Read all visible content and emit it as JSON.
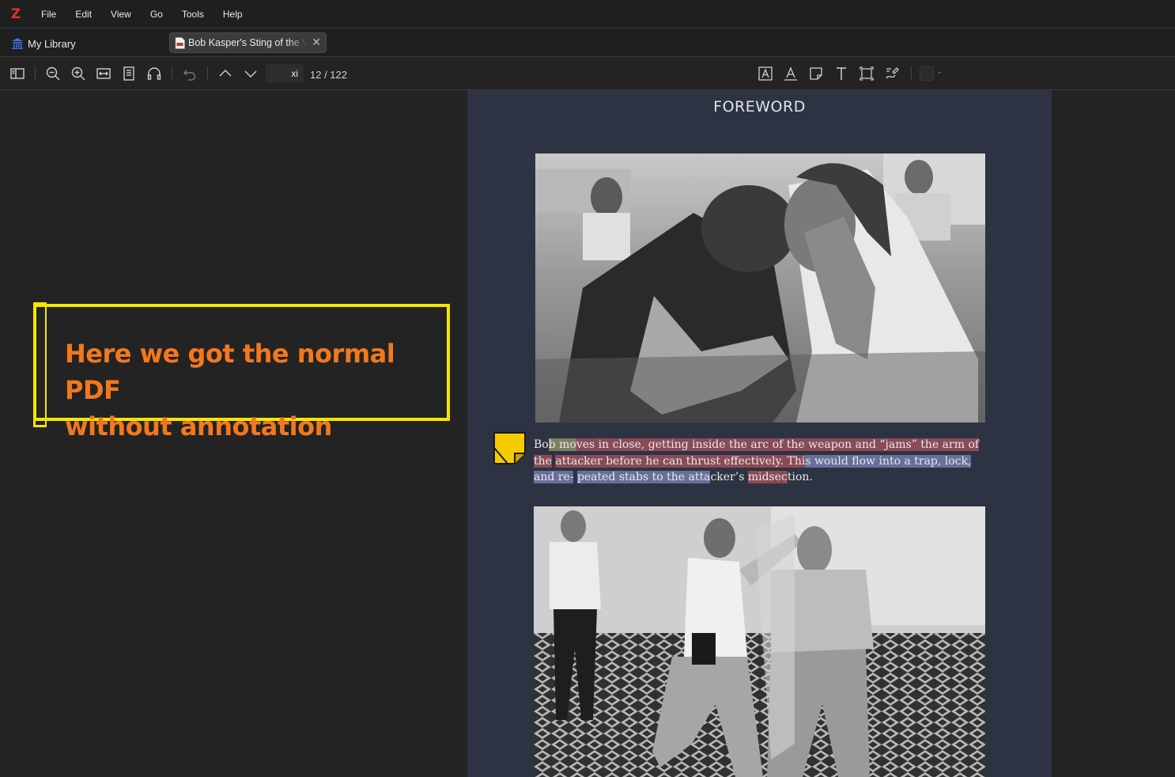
{
  "app": {
    "logo": "Z",
    "menu": [
      "File",
      "Edit",
      "View",
      "Go",
      "Tools",
      "Help"
    ]
  },
  "tabs": {
    "library_label": "My Library",
    "doc_title": "Bob Kasper's Sting of the Viper"
  },
  "toolbar": {
    "page_label": "xi",
    "page_count": "12 / 122",
    "icons": [
      "sidebar-toggle-icon",
      "zoom-out-icon",
      "zoom-in-icon",
      "fit-width-icon",
      "page-view-icon",
      "read-aloud-icon",
      "undo-icon",
      "previous-page-icon",
      "next-page-icon",
      "highlight-text-icon",
      "underline-text-icon",
      "add-note-icon",
      "add-text-icon",
      "select-area-icon",
      "draw-icon",
      "color-picker-icon"
    ]
  },
  "callout": {
    "line1": "Here we got the normal PDF",
    "line2": "without annotation"
  },
  "page": {
    "heading": "FOREWORD",
    "caption": {
      "seg1": "Bo",
      "seg2": "b mo",
      "seg3": "ves in close, getting inside the arc of the weapon and “jams” the arm of the",
      "seg4": "attacker before he can thrust effectively. Thi",
      "seg5": "s would flow into a trap, lock, and re-",
      "seg6": "peated stabs to the atta",
      "seg7": "cker’s ",
      "seg8": "midsec",
      "seg9": "tion."
    }
  },
  "colors": {
    "callout_border": "#f6e600",
    "callout_text": "#f2781f",
    "highlight_red": "#8a4b56",
    "highlight_blue": "#676f9a",
    "highlight_yellow": "#7d8060",
    "note": "#f5cc00"
  }
}
